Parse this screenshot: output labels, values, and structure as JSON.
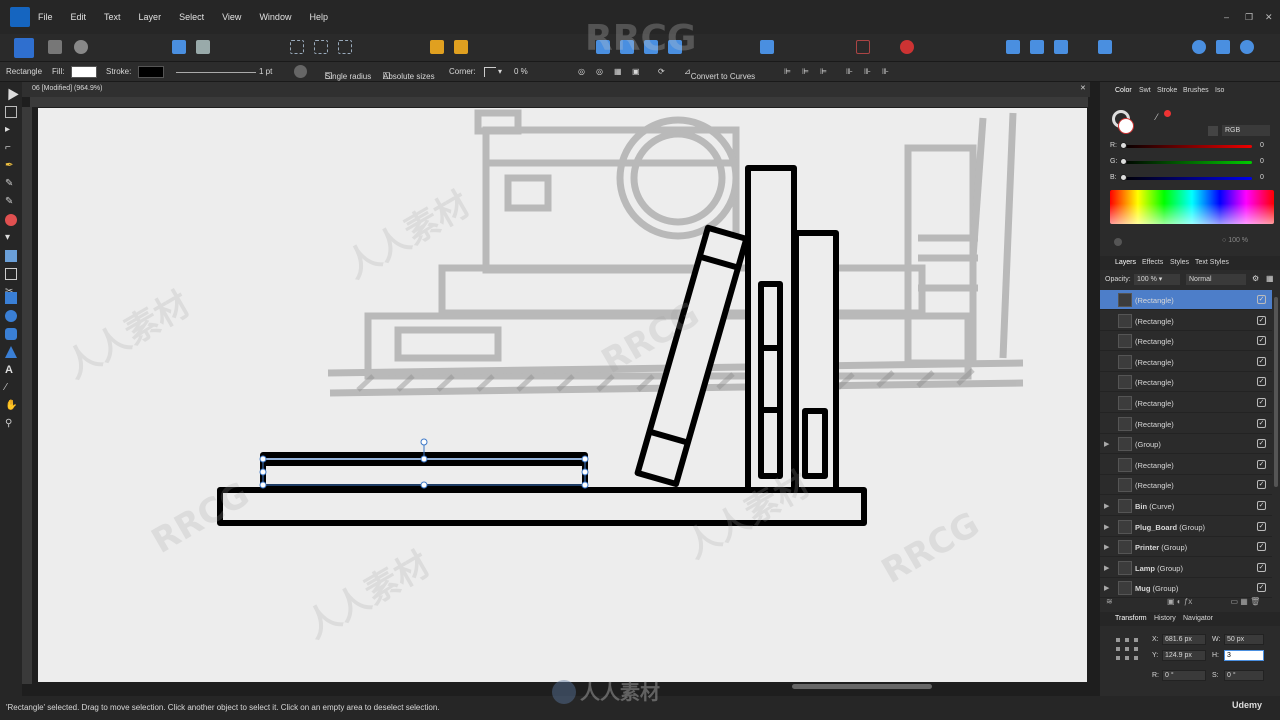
{
  "menu": {
    "items": [
      "File",
      "Edit",
      "Text",
      "Layer",
      "Select",
      "View",
      "Window",
      "Help"
    ]
  },
  "window_controls": {
    "minimize": "–",
    "restore": "❐",
    "close": "✕"
  },
  "context_toolbar": {
    "tool_name": "Rectangle",
    "fill_label": "Fill:",
    "stroke_label": "Stroke:",
    "stroke_width": "1 pt",
    "single_radius_label": "Single radius",
    "absolute_sizes_label": "Absolute sizes",
    "corner_label": "Corner:",
    "corner_percent": "0 %",
    "convert_to_curves_label": "Convert to Curves",
    "fill_color": "#ffffff",
    "stroke_color": "#000000"
  },
  "document": {
    "tab_title": "06 [Modified] (964.9%)"
  },
  "status": {
    "text": "'Rectangle' selected. Drag to move selection. Click another object to select it. Click on an empty area to deselect selection."
  },
  "color_panel": {
    "tabs": [
      "Color",
      "Swt",
      "Stroke",
      "Brushes",
      "Iso"
    ],
    "mode": "RGB",
    "r_label": "R:",
    "r_value": "0",
    "g_label": "G:",
    "g_value": "0",
    "b_label": "B:",
    "b_value": "0",
    "opacity": "100 %"
  },
  "layers_panel": {
    "tabs": [
      "Layers",
      "Effects",
      "Styles",
      "Text Styles"
    ],
    "opacity_label": "Opacity:",
    "opacity_value": "100 %",
    "blend_mode": "Normal",
    "layers": [
      {
        "name": "(Rectangle)",
        "selected": true,
        "group": false,
        "bold": ""
      },
      {
        "name": "(Rectangle)",
        "selected": false,
        "group": false,
        "bold": ""
      },
      {
        "name": "(Rectangle)",
        "selected": false,
        "group": false,
        "bold": ""
      },
      {
        "name": "(Rectangle)",
        "selected": false,
        "group": false,
        "bold": ""
      },
      {
        "name": "(Rectangle)",
        "selected": false,
        "group": false,
        "bold": ""
      },
      {
        "name": "(Rectangle)",
        "selected": false,
        "group": false,
        "bold": ""
      },
      {
        "name": "(Rectangle)",
        "selected": false,
        "group": false,
        "bold": ""
      },
      {
        "name": "(Group)",
        "selected": false,
        "group": true,
        "bold": ""
      },
      {
        "name": "(Rectangle)",
        "selected": false,
        "group": false,
        "bold": ""
      },
      {
        "name": "(Rectangle)",
        "selected": false,
        "group": false,
        "bold": ""
      },
      {
        "name": "(Curve)",
        "selected": false,
        "group": true,
        "bold": "Bin"
      },
      {
        "name": "(Group)",
        "selected": false,
        "group": true,
        "bold": "Plug_Board"
      },
      {
        "name": "(Group)",
        "selected": false,
        "group": true,
        "bold": "Printer"
      },
      {
        "name": "(Group)",
        "selected": false,
        "group": true,
        "bold": "Lamp"
      },
      {
        "name": "(Group)",
        "selected": false,
        "group": true,
        "bold": "Mug"
      }
    ]
  },
  "transform_panel": {
    "tabs": [
      "Transform",
      "History",
      "Navigator"
    ],
    "x_label": "X:",
    "x_value": "681.6 px",
    "y_label": "Y:",
    "y_value": "124.9 px",
    "w_label": "W:",
    "w_value": "50 px",
    "h_label": "H:",
    "h_value": "3",
    "r_label": "R:",
    "r_value": "0 °",
    "s_label": "S:",
    "s_value": "0 °"
  },
  "watermarks": {
    "brand": "RRCG",
    "site": "人人素材",
    "udemy": "Udemy"
  }
}
